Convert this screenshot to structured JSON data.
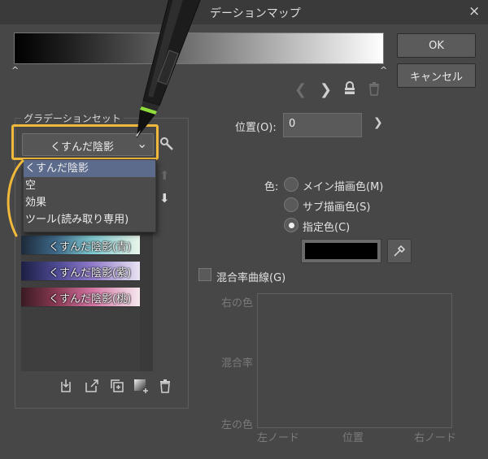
{
  "window": {
    "title": "デーションマップ",
    "close_glyph": "×"
  },
  "buttons": {
    "ok": "OK",
    "cancel": "キャンセル"
  },
  "gradient_bar": {
    "node_glyph": "^"
  },
  "toolbar_icons": [
    "chevron-left-icon",
    "chevron-right-icon",
    "lock-icon",
    "trash-icon"
  ],
  "gradient_set": {
    "label": "グラデーションセット",
    "selected": "くすんだ陰影",
    "dropdown_items": [
      "くすんだ陰影",
      "空",
      "効果",
      "ツール(読み取り専用)"
    ],
    "gradients": [
      "くすんだ陰影(青)",
      "くすんだ陰影(紫)",
      "くすんだ陰影(桃)"
    ]
  },
  "position": {
    "label": "位置(O):",
    "value": "0"
  },
  "color": {
    "label": "色:",
    "options": [
      "メイン描画色(M)",
      "サブ描画色(S)",
      "指定色(C)"
    ],
    "selected_index": 2,
    "specified_color": "#000000"
  },
  "blend_curve": {
    "label": "混合率曲線(G)",
    "checked": false,
    "y_top": "右の色",
    "y_mid": "混合率",
    "y_bottom": "左の色",
    "x_left": "左ノード",
    "x_mid": "位置",
    "x_right": "右ノード"
  },
  "colors": {
    "highlight": "#f0b93a",
    "background": "#474747"
  }
}
